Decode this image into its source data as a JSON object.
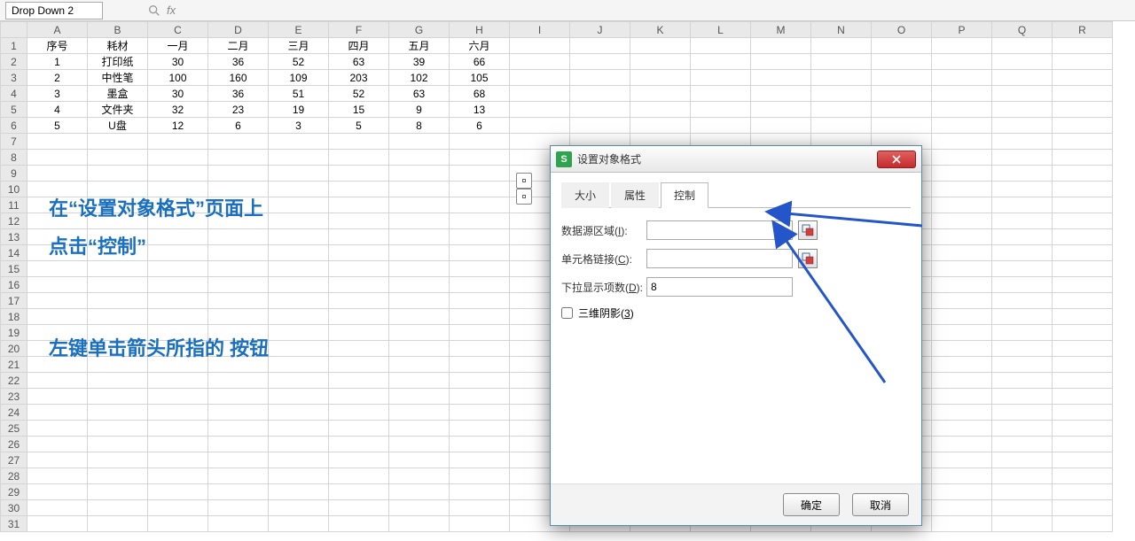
{
  "namebox": "Drop Down 2",
  "columns": [
    "A",
    "B",
    "C",
    "D",
    "E",
    "F",
    "G",
    "H",
    "I",
    "J",
    "K",
    "L",
    "M",
    "N",
    "O",
    "P",
    "Q",
    "R"
  ],
  "row_headers": [
    1,
    2,
    3,
    4,
    5,
    6,
    7,
    8,
    9,
    10,
    11,
    12,
    13,
    14,
    15,
    16,
    17,
    18,
    19,
    20,
    21,
    22,
    23,
    24,
    25,
    26,
    27,
    28,
    29,
    30,
    31
  ],
  "table": {
    "headers": [
      "序号",
      "耗材",
      "一月",
      "二月",
      "三月",
      "四月",
      "五月",
      "六月"
    ],
    "rows": [
      [
        "1",
        "打印纸",
        "30",
        "36",
        "52",
        "63",
        "39",
        "66"
      ],
      [
        "2",
        "中性笔",
        "100",
        "160",
        "109",
        "203",
        "102",
        "105"
      ],
      [
        "3",
        "墨盒",
        "30",
        "36",
        "51",
        "52",
        "63",
        "68"
      ],
      [
        "4",
        "文件夹",
        "32",
        "23",
        "19",
        "15",
        "9",
        "13"
      ],
      [
        "5",
        "U盘",
        "12",
        "6",
        "3",
        "5",
        "8",
        "6"
      ]
    ]
  },
  "annotations": {
    "line1": "在“设置对象格式”页面上",
    "line2": "点击“控制”",
    "line3": "左键单击箭头所指的 按钮"
  },
  "dialog": {
    "title": "设置对象格式",
    "tabs": {
      "size": "大小",
      "attr": "属性",
      "control": "控制"
    },
    "fields": {
      "source_label": "数据源区域(",
      "source_u": "I",
      "source_label2": "):",
      "source_value": "",
      "link_label": "单元格链接(",
      "link_u": "C",
      "link_label2": "):",
      "link_value": "",
      "count_label": "下拉显示项数(",
      "count_u": "D",
      "count_label2": "):",
      "count_value": "8",
      "shadow_label": "三维阴影(",
      "shadow_u": "3",
      "shadow_label2": ")"
    },
    "buttons": {
      "ok": "确定",
      "cancel": "取消"
    }
  }
}
